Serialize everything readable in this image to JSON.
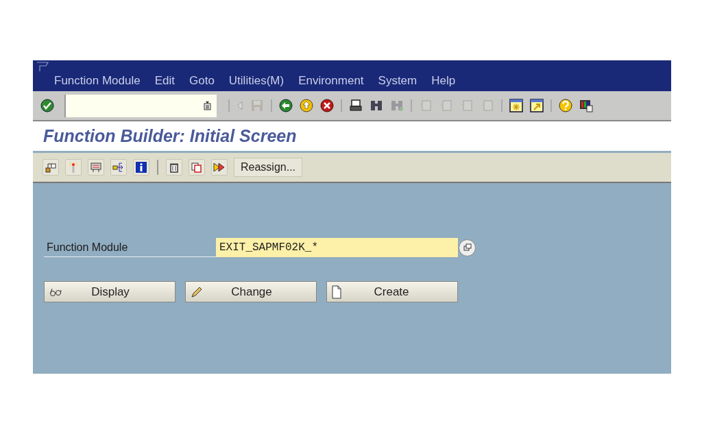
{
  "menu": [
    "Function Module",
    "Edit",
    "Goto",
    "Utilities(M)",
    "Environment",
    "System",
    "Help"
  ],
  "standard_toolbar": [
    {
      "kind": "enter",
      "disabled": false
    },
    {
      "kind": "command_field"
    },
    {
      "kind": "sep"
    },
    {
      "kind": "left",
      "disabled": true
    },
    {
      "kind": "save",
      "disabled": true
    },
    {
      "kind": "sep"
    },
    {
      "kind": "back",
      "disabled": false
    },
    {
      "kind": "exit",
      "disabled": false
    },
    {
      "kind": "cancel",
      "disabled": false
    },
    {
      "kind": "sep"
    },
    {
      "kind": "print",
      "disabled": false
    },
    {
      "kind": "find",
      "disabled": false
    },
    {
      "kind": "find_next",
      "disabled": true
    },
    {
      "kind": "sep"
    },
    {
      "kind": "page",
      "disabled": true
    },
    {
      "kind": "page",
      "disabled": true
    },
    {
      "kind": "page",
      "disabled": true
    },
    {
      "kind": "page",
      "disabled": true
    },
    {
      "kind": "sep"
    },
    {
      "kind": "new_session",
      "disabled": false
    },
    {
      "kind": "shortcut",
      "disabled": false
    },
    {
      "kind": "sep"
    },
    {
      "kind": "help",
      "disabled": false
    },
    {
      "kind": "layout",
      "disabled": false
    }
  ],
  "title": "Function Builder: Initial Screen",
  "app_toolbar": [
    {
      "kind": "hierarchy"
    },
    {
      "kind": "spark"
    },
    {
      "kind": "display_object"
    },
    {
      "kind": "where_used"
    },
    {
      "kind": "info"
    },
    {
      "kind": "sep"
    },
    {
      "kind": "trash"
    },
    {
      "kind": "copy"
    },
    {
      "kind": "rename"
    },
    {
      "kind": "text",
      "label": "Reassign..."
    }
  ],
  "field": {
    "label": "Function Module",
    "value": "EXIT_SAPMF02K_*"
  },
  "buttons": [
    {
      "kind": "display",
      "label": "Display"
    },
    {
      "kind": "change",
      "label": "Change"
    },
    {
      "kind": "create",
      "label": "Create"
    }
  ]
}
